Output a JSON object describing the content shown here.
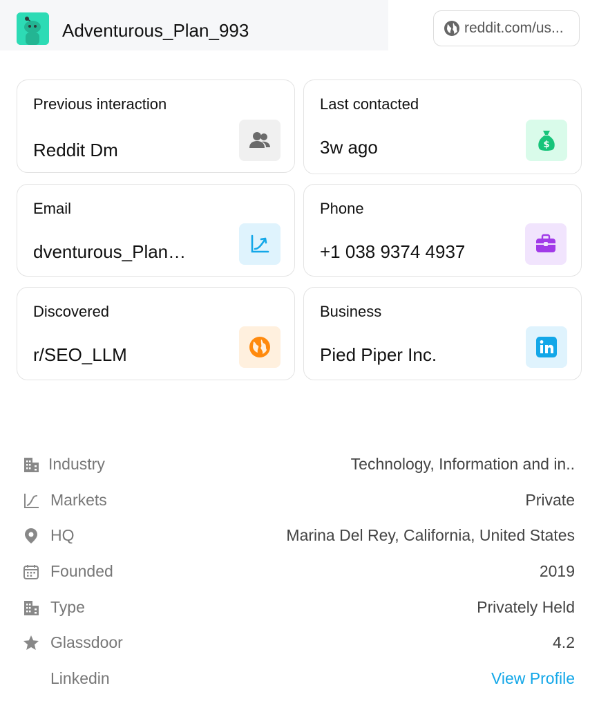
{
  "header": {
    "username": "Adventurous_Plan_993",
    "url": "reddit.com/us..."
  },
  "cards": {
    "previous_interaction": {
      "label": "Previous interaction",
      "value": "Reddit Dm"
    },
    "last_contacted": {
      "label": "Last contacted",
      "value": "3w ago"
    },
    "email": {
      "label": "Email",
      "value": "dventurous_Plan…"
    },
    "phone": {
      "label": "Phone",
      "value": "+1 038 9374 4937"
    },
    "discovered": {
      "label": "Discovered",
      "value": "r/SEO_LLM"
    },
    "business": {
      "label": "Business",
      "value": "Pied Piper Inc."
    }
  },
  "details": {
    "industry": {
      "label": "Industry",
      "value": "Technology, Information and in.."
    },
    "markets": {
      "label": "Markets",
      "value": "Private"
    },
    "hq": {
      "label": "HQ",
      "value": "Marina Del Rey, California, United States"
    },
    "founded": {
      "label": "Founded",
      "value": "2019"
    },
    "type": {
      "label": "Type",
      "value": "Privately Held"
    },
    "glassdoor": {
      "label": "Glassdoor",
      "value": "4.2"
    },
    "linkedin": {
      "label": "Linkedin",
      "value": "View Profile"
    }
  },
  "colors": {
    "avatar_bg": "#2ddbb5",
    "link": "#13a7e8",
    "badge_people": "#f0f0f0",
    "badge_money": "#d9fbea",
    "badge_chart": "#dff3fd",
    "badge_briefcase": "#f1e4fd",
    "badge_globe": "#fff0de",
    "badge_linkedin": "#dff3fd"
  }
}
